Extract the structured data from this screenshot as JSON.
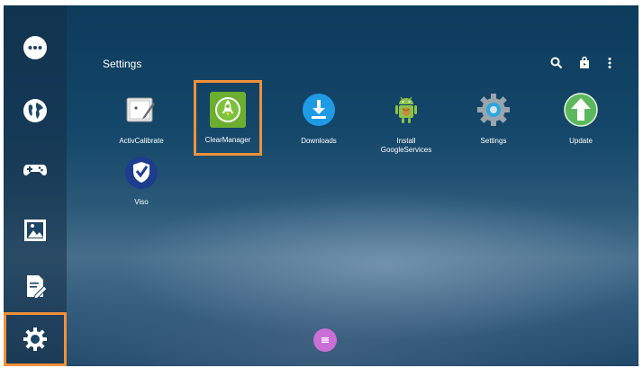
{
  "header": {
    "title": "Settings",
    "actions": [
      {
        "icon": "search-icon"
      },
      {
        "icon": "store-bag-icon"
      },
      {
        "icon": "more-vert-icon"
      }
    ]
  },
  "sidebar": {
    "items": [
      {
        "icon": "chat-bubble-icon"
      },
      {
        "icon": "globe-icon"
      },
      {
        "icon": "gamepad-icon"
      },
      {
        "icon": "media-image-icon"
      },
      {
        "icon": "document-edit-icon"
      },
      {
        "icon": "gear-icon",
        "selected": true
      }
    ]
  },
  "apps": [
    {
      "label": "ActivCalibrate",
      "icon": "calibrate-icon"
    },
    {
      "label": "ClearManager",
      "icon": "rocket-icon",
      "selected": true
    },
    {
      "label": "Downloads",
      "icon": "download-icon"
    },
    {
      "label": "Install\nGoogleServices",
      "icon": "android-icon"
    },
    {
      "label": "Settings",
      "icon": "gear-icon"
    },
    {
      "label": "Update",
      "icon": "arrow-up-icon"
    },
    {
      "label": "Viso",
      "icon": "shield-check-icon"
    }
  ],
  "bottom": {
    "menu_icon": "menu-lines-icon"
  },
  "colors": {
    "highlight": "#f0913a",
    "menu_button": "#c96fd6"
  }
}
